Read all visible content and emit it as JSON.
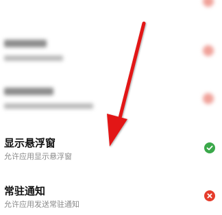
{
  "permissions": [
    {
      "title": "显示悬浮窗",
      "subtitle": "允许应用显示悬浮窗",
      "status": "allowed",
      "status_icon": "check-icon",
      "status_color": "#3aa84a"
    },
    {
      "title": "常驻通知",
      "subtitle": "允许应用发送常驻通知",
      "status": "denied",
      "status_icon": "close-icon",
      "status_color": "#e53c2c"
    }
  ],
  "colors": {
    "arrow": "#e21818",
    "blurred_status": "#f0a29a"
  }
}
